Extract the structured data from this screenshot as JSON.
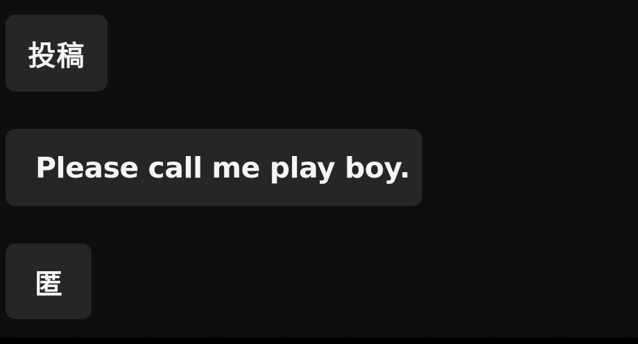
{
  "messages": [
    {
      "text": "投稿"
    },
    {
      "text": "Please call me play boy."
    },
    {
      "text": "匿"
    }
  ]
}
